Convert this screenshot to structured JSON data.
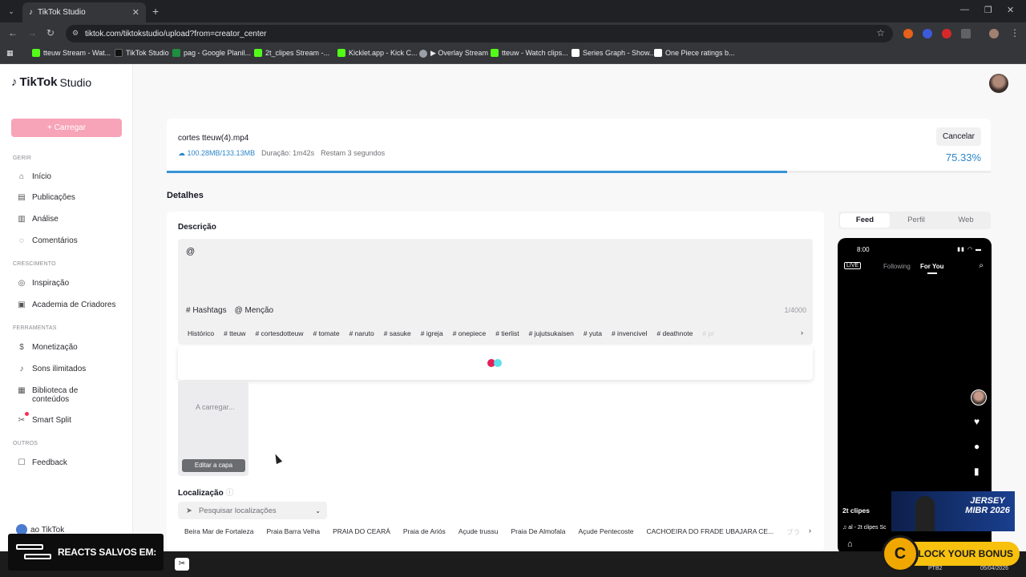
{
  "browser": {
    "tab_title": "TikTok Studio",
    "new_tab": "+",
    "url": "tiktok.com/tiktokstudio/upload?from=creator_center",
    "window_controls": [
      "—",
      "❐",
      "✕"
    ],
    "bookmarks": [
      {
        "label": "tteuw Stream - Wat...",
        "color": "#53fc18"
      },
      {
        "label": "TikTok Studio",
        "color": "#111111"
      },
      {
        "label": "pag - Google Planil...",
        "color": "#1e8e3e"
      },
      {
        "label": "2t_clipes Stream -...",
        "color": "#53fc18"
      },
      {
        "label": "Kicklet.app - Kick C...",
        "color": "#53fc18"
      },
      {
        "label": "▶ Overlay Stream",
        "color": "#9aa0a6"
      },
      {
        "label": "tteuw - Watch clips...",
        "color": "#53fc18"
      },
      {
        "label": "Series Graph - Show...",
        "color": "#ffffff"
      },
      {
        "label": "One Piece ratings b...",
        "color": "#ffffff"
      }
    ]
  },
  "app": {
    "logo": "TikTok",
    "logo_suffix": "Studio",
    "upload_button": "+ Carregar"
  },
  "sidebar": {
    "sections": {
      "gerir": "GERIR",
      "crescimento": "CRESCIMENTO",
      "ferramentas": "FERRAMENTAS",
      "outros": "OUTROS"
    },
    "items": {
      "inicio": "Início",
      "publicacoes": "Publicações",
      "analise": "Análise",
      "comentarios": "Comentários",
      "inspiracao": "Inspiração",
      "academia": "Academia de Criadores",
      "monetizacao": "Monetização",
      "sons": "Sons ilimitados",
      "biblioteca_1": "Biblioteca de",
      "biblioteca_2": "conteúdos",
      "smart_split": "Smart Split",
      "feedback": "Feedback"
    },
    "bottom_link": "ao TikTok"
  },
  "upload": {
    "filename": "cortes tteuw(4).mp4",
    "size": "100.28MB/133.13MB",
    "duration": "Duração: 1m42s",
    "remaining": "Restam 3 segundos",
    "cancel": "Cancelar",
    "percent_label": "75.33%",
    "progress": 0.7533
  },
  "details": {
    "title": "Detalhes",
    "description_label": "Descrição",
    "description_value": "@",
    "hashtags_btn": "# Hashtags",
    "mention_btn": "@ Menção",
    "char_count": "1/4000",
    "history_label": "Histórico",
    "history_tags": [
      "# tteuw",
      "# cortesdotteuw",
      "# tomate",
      "# naruto",
      "# sasuke",
      "# igreja",
      "# onepiece",
      "# tierlist",
      "# jujutsukaisen",
      "# yuta",
      "# invencivel",
      "# deathnote"
    ],
    "history_tag_faded": "# pr",
    "cover_loading": "A carregar...",
    "cover_button": "Editar a capa",
    "location_label": "Localização",
    "location_placeholder": "Pesquisar localizações",
    "location_suggestions": [
      "Beira Mar de Fortaleza",
      "Praia Barra Velha",
      "PRAIA DO CEARÁ",
      "Praia de Ariós",
      "Açude trussu",
      "Praia De Almofala",
      "Açude Pentecoste",
      "CACHOEIRA DO FRADE UBAJARA CE..."
    ],
    "location_faded": "ブラ"
  },
  "preview": {
    "tabs": [
      "Feed",
      "Perfil",
      "Web"
    ],
    "active_tab": "Feed",
    "phone_time": "8:00",
    "following": "Following",
    "for_you": "For You",
    "username": "2t clipes",
    "music_line": "♫ al - 2t clipes  Sc"
  },
  "overlays": {
    "react_text": "REACTS SALVOS EM:",
    "ad_title": "JERSEY MIBR 2026",
    "ad_brand": "mibr",
    "unlock_text": "UNLOCK YOUR BONUS"
  },
  "taskbar": {
    "lang": "PTB2",
    "date": "05/04/2026"
  }
}
